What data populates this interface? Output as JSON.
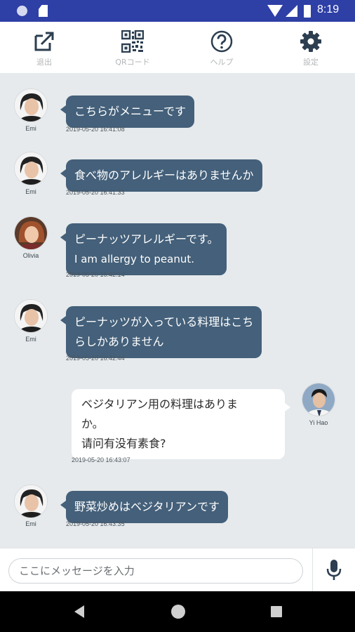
{
  "status_bar": {
    "time": "8:19"
  },
  "toolbar": {
    "items": [
      {
        "label": "退出",
        "icon": "exit-icon"
      },
      {
        "label": "QRコード",
        "icon": "qr-code-icon"
      },
      {
        "label": "ヘルプ",
        "icon": "help-icon"
      },
      {
        "label": "設定",
        "icon": "gear-icon"
      }
    ]
  },
  "colors": {
    "status_bar": "#2e3fa6",
    "incoming_bubble": "#44607a",
    "outgoing_bubble": "#ffffff",
    "chat_background": "#e6eaec",
    "icon": "#2c3e50"
  },
  "messages": [
    {
      "sender": "Emi",
      "lines": [
        "こちらがメニューです"
      ],
      "timestamp": "2019-05-20 16:41:08"
    },
    {
      "sender": "Emi",
      "lines": [
        "食べ物のアレルギーはありませんか"
      ],
      "timestamp": "2019-05-20 16:41:33"
    },
    {
      "sender": "Olivia",
      "lines": [
        "ピーナッツアレルギーです。",
        "I am allergy to peanut."
      ],
      "timestamp": "2019-05-20 16:42:14"
    },
    {
      "sender": "Emi",
      "lines": [
        "ピーナッツが入っている料理はこち",
        "らしかありません"
      ],
      "timestamp": "2019-05-20 16:42:44"
    },
    {
      "sender": "Yi Hao",
      "lines": [
        "ベジタリアン用の料理はありま",
        "か。",
        "请问有没有素食?"
      ],
      "timestamp": "2019-05-20 16:43:07"
    },
    {
      "sender": "Emi",
      "lines": [
        "野菜炒めはベジタリアンです"
      ],
      "timestamp": "2019-05-20 16:43:35"
    }
  ],
  "input": {
    "placeholder": "ここにメッセージを入力",
    "value": ""
  }
}
